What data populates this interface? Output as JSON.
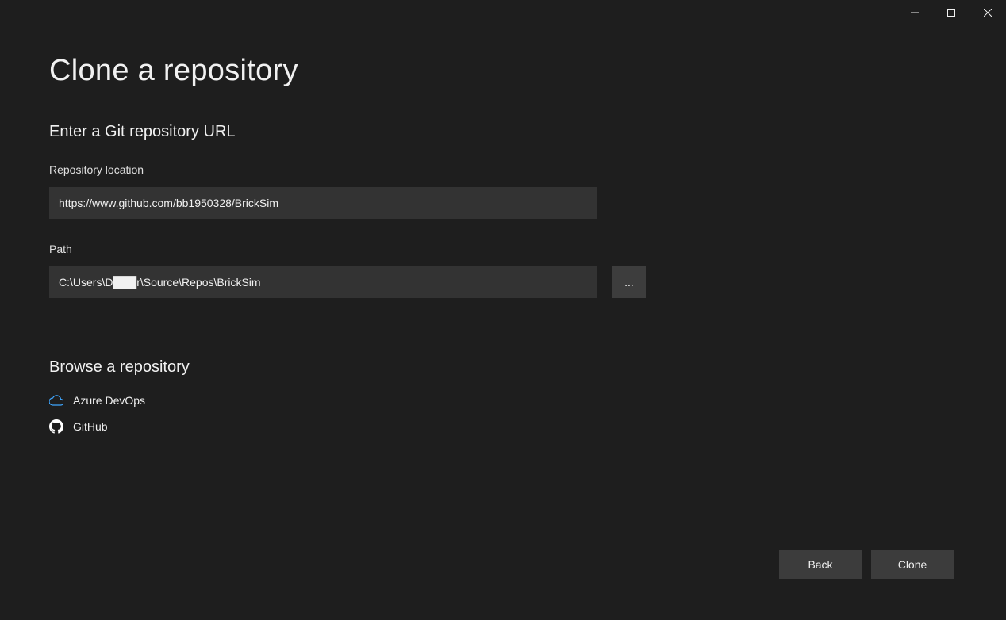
{
  "title": "Clone a repository",
  "section_git": {
    "heading": "Enter a Git repository URL",
    "repo_label": "Repository location",
    "repo_value": "https://www.github.com/bb1950328/BrickSim",
    "path_label": "Path",
    "path_value": "C:\\Users\\D███r\\Source\\Repos\\BrickSim",
    "browse_label": "..."
  },
  "section_browse": {
    "heading": "Browse a repository",
    "azure_label": "Azure DevOps",
    "github_label": "GitHub"
  },
  "footer": {
    "back": "Back",
    "clone": "Clone"
  }
}
